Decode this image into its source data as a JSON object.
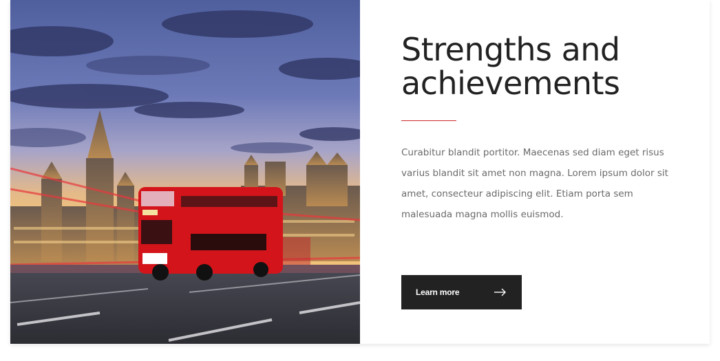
{
  "feature": {
    "image_description_icon": "london-bus-photo",
    "title": "Strengths and achievements",
    "body": "Curabitur blandit portitor. Maecenas sed diam eget risus varius blandit sit amet non magna. Lorem ipsum dolor sit amet, consecteur adipiscing elit. Etiam porta sem malesuada magna mollis euismod.",
    "button_label": "Learn more",
    "button_icon": "arrow-right-icon"
  },
  "colors": {
    "accent": "#c8262b",
    "heading": "#222222",
    "body": "#6a6a6a",
    "button_bg": "#222222",
    "button_text": "#ffffff"
  }
}
